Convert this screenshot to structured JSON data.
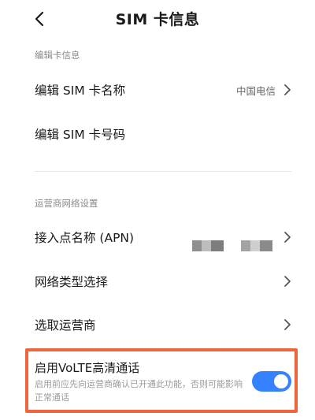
{
  "header": {
    "title": "SIM 卡信息",
    "back_icon": "chevron-left-icon"
  },
  "sections": {
    "edit_card": {
      "label": "编辑卡信息",
      "name_row": {
        "label": "编辑 SIM 卡名称",
        "value": "中国电信"
      },
      "number_row": {
        "label": "编辑 SIM 卡号码"
      }
    },
    "carrier": {
      "label": "运营商网络设置",
      "apn_row": {
        "label": "接入点名称 (APN)"
      },
      "network_type_row": {
        "label": "网络类型选择"
      },
      "operator_row": {
        "label": "选取运营商"
      }
    },
    "volte": {
      "title": "启用VoLTE高清通话",
      "description": "启用前应先向运营商确认已开通此功能，否则可能影响正常通话",
      "enabled": true
    }
  },
  "colors": {
    "accent": "#3482ff",
    "highlight_border": "#f0663c",
    "secondary_text": "#8a8a8a"
  }
}
